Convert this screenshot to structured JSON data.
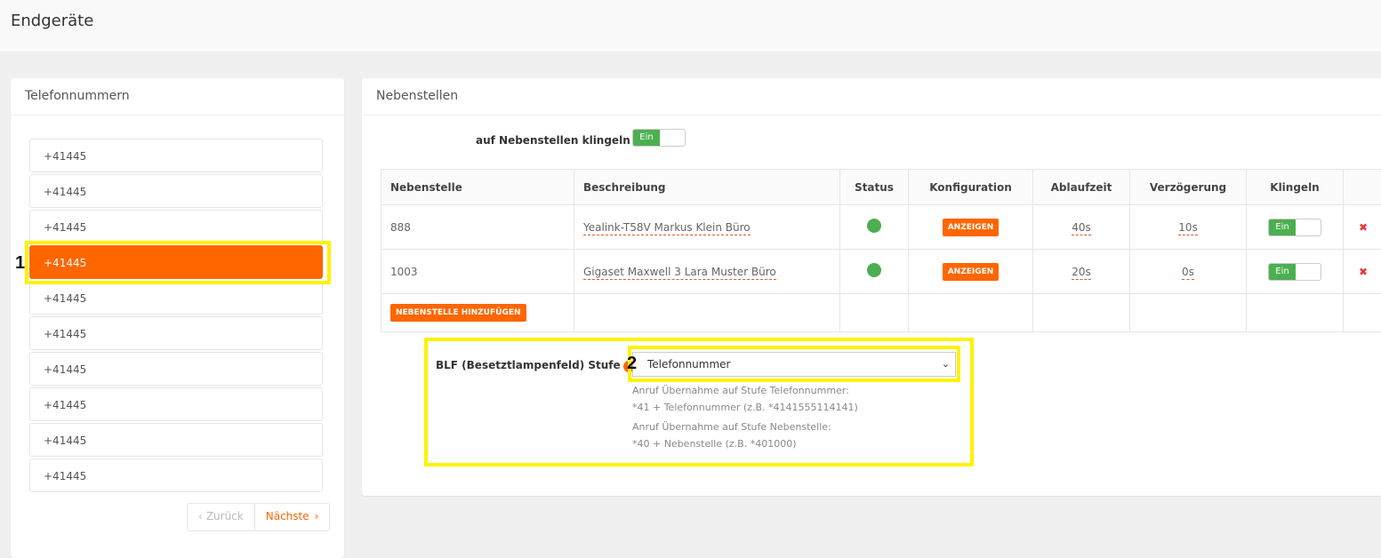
{
  "page": {
    "title": "Endgeräte"
  },
  "left": {
    "title": "Telefonnummern",
    "numbers": [
      "+41445",
      "+41445",
      "+41445",
      "+41445",
      "+41445",
      "+41445",
      "+41445",
      "+41445",
      "+41445",
      "+41445"
    ],
    "active_index": 3,
    "pager": {
      "prev": "Zurück",
      "next": "Nächste"
    }
  },
  "right": {
    "title": "Nebenstellen",
    "ring_label": "auf Nebenstellen klingeln",
    "ring_toggle": "Ein",
    "table": {
      "headers": [
        "Nebenstelle",
        "Beschreibung",
        "Status",
        "Konfiguration",
        "Ablaufzeit",
        "Verzögerung",
        "Klingeln"
      ],
      "rows": [
        {
          "ext": "888",
          "desc": "Yealink-T58V Markus Klein Büro",
          "config": "ANZEIGEN",
          "timeout": "40s",
          "delay": "10s",
          "ring": "Ein"
        },
        {
          "ext": "1003",
          "desc": "Gigaset Maxwell 3 Lara Muster Büro",
          "config": "ANZEIGEN",
          "timeout": "20s",
          "delay": "0s",
          "ring": "Ein"
        }
      ],
      "add_label": "NEBENSTELLE HINZUFÜGEN"
    },
    "blf": {
      "label": "BLF (Besetztlampenfeld) Stufe",
      "selected": "Telefonnummer",
      "help1a": "Anruf Übernahme auf Stufe Telefonnummer:",
      "help1b": "*41 + Telefonnummer (z.B. *4141555114141)",
      "help2a": "Anruf Übernahme auf Stufe Nebenstelle:",
      "help2b": "*40 + Nebenstelle (z.B. *401000)"
    }
  },
  "annotations": {
    "marker1": "1",
    "marker2": "2"
  },
  "colors": {
    "accent": "#ff6600",
    "success": "#4caf50",
    "highlight": "#fff200",
    "danger": "#e53935"
  }
}
